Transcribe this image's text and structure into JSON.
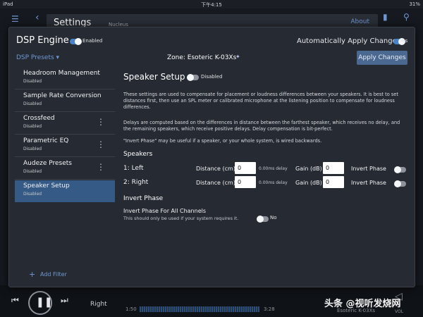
{
  "status_bar": {
    "device": "iPad",
    "time": "下午4:15",
    "battery": "31%"
  },
  "background": {
    "header_title": "Settings",
    "header_subtitle": "Nucleus",
    "about_label": "About",
    "player": {
      "right_text": "Right",
      "time_elapsed": "1:50",
      "time_total": "3:28",
      "zone": "Esoteric K-03Xs",
      "vol_label": "VOL"
    }
  },
  "watermark": "头条 @视听发烧网",
  "dialog": {
    "title": "DSP Engine",
    "engine_state": "Enabled",
    "auto_apply_label": "Automatically Apply Changes",
    "auto_apply_state": "Yes",
    "presets_label": "DSP Presets ▾",
    "zone_label": "Zone: Esoteric K-03Xs",
    "apply_button": "Apply Changes",
    "add_filter": "Add Filter"
  },
  "filters": [
    {
      "name": "Headroom Management",
      "status": "Disabled",
      "more": false,
      "active": false
    },
    {
      "name": "Sample Rate Conversion",
      "status": "Disabled",
      "more": false,
      "active": false
    },
    {
      "name": "Crossfeed",
      "status": "Disabled",
      "more": true,
      "active": false
    },
    {
      "name": "Parametric EQ",
      "status": "Disabled",
      "more": true,
      "active": false
    },
    {
      "name": "Audeze Presets",
      "status": "Disabled",
      "more": true,
      "active": false
    },
    {
      "name": "Speaker Setup",
      "status": "Disabled",
      "more": false,
      "active": true
    }
  ],
  "speaker_setup": {
    "title": "Speaker Setup",
    "state": "Disabled",
    "para1": "These settings are used to compensate for placement or loudness differences between your speakers. It is best to set distances first, then use an SPL meter or calibrated microphone at the listening position to compensate for loudness differences.",
    "para2": "Delays are computed based on the differences in distance between the farthest speaker, which receives no delay, and the remaining speakers, which receive positive delays. Delay compensation is bit-perfect.",
    "para3": "\"Invert Phase\" may be useful if a speaker, or your whole system, is wired backwards.",
    "speakers_heading": "Speakers",
    "distance_label": "Distance (cm)",
    "gain_label": "Gain (dB)",
    "invert_label": "Invert Phase",
    "speakers": [
      {
        "name": "1: Left",
        "distance": "0",
        "delay": "0.00ms delay",
        "gain": "0"
      },
      {
        "name": "2: Right",
        "distance": "0",
        "delay": "0.00ms delay",
        "gain": "0"
      }
    ],
    "invert_heading": "Invert Phase",
    "invert_all_label": "Invert Phase For All Channels",
    "invert_all_note": "This should only be used if your system requires it.",
    "invert_all_state": "No"
  }
}
